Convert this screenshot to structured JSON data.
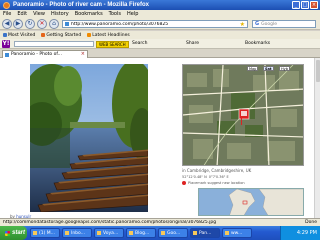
{
  "window": {
    "title": "Panoramio - Photo of river cam - Mozilla Firefox"
  },
  "menu": {
    "items": [
      "File",
      "Edit",
      "View",
      "History",
      "Bookmarks",
      "Tools",
      "Help"
    ]
  },
  "nav": {
    "url": "http://www.panoramio.com/photo/3076825",
    "search_engine": "G",
    "search_placeholder": "Google"
  },
  "bookmarks": {
    "items": [
      "Most Visited",
      "Getting Started",
      "Latest Headlines"
    ]
  },
  "toolbar": {
    "yahoo_label": "Y!",
    "web_search_label": "WEB SEARCH",
    "search_label": "Search",
    "share_label": "Share",
    "bookmarks_label": "Bookmarks"
  },
  "tabs": [
    {
      "label": "Panoramio - Photo of...",
      "active": true
    }
  ],
  "content": {
    "map_buttons": [
      "Map",
      "Sat",
      "Hyb"
    ],
    "map_caption": "in Cambridge, Cambridgeshire, UK",
    "coords": [
      "52°12'0.48\" N",
      "0°7'0.36\" E"
    ],
    "placemark_text": "Placemark suggest new location",
    "credit_by": "by",
    "credit_author": "hunsulr"
  },
  "status": {
    "text": "http://commondatastorage.googleapis.com/static.panoramio.com/photos/original/3076825.jpg",
    "done": "Done"
  },
  "taskbar": {
    "start": "start",
    "items": [
      "(1) M...",
      "Inbo...",
      "Voya...",
      "Blog...",
      "Goo...",
      "Pan...",
      "ww..."
    ],
    "clock": "4:29 PM"
  },
  "colors": {
    "titlebar": "#1c4fb3",
    "taskbar": "#245ad0",
    "start": "#2f8f2f"
  }
}
